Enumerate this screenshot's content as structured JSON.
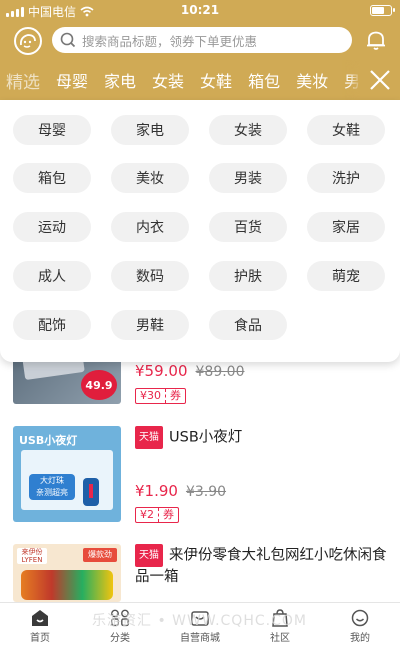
{
  "status": {
    "carrier": "中国电信",
    "time": "10:21"
  },
  "header": {
    "search_placeholder": "搜索商品标题，领券下单更优惠"
  },
  "category_tabs": [
    "精选",
    "母婴",
    "家电",
    "女装",
    "女鞋",
    "箱包",
    "美妆",
    "男"
  ],
  "category_panel": [
    "母婴",
    "家电",
    "女装",
    "女鞋",
    "箱包",
    "美妆",
    "男装",
    "洗护",
    "运动",
    "内衣",
    "百货",
    "家居",
    "成人",
    "数码",
    "护肤",
    "萌宠",
    "配饰",
    "男鞋",
    "食品"
  ],
  "products": [
    {
      "thumb_label": "49.9",
      "price": "¥59.00",
      "old_price": "¥89.00",
      "coupon_amount": "¥30",
      "coupon_label": "券"
    },
    {
      "shop_badge": "天猫",
      "title": "USB小夜灯",
      "thumb_label": "USB小夜灯",
      "thumb_sub": "大灯珠",
      "thumb_sub2": "亲测超亮",
      "price": "¥1.90",
      "old_price": "¥3.90",
      "coupon_amount": "¥2",
      "coupon_label": "券"
    },
    {
      "shop_badge": "天猫",
      "title": "来伊份零食大礼包网红小吃休闲食品一箱",
      "thumb_label": "来伊份",
      "thumb_sub": "LYFEN",
      "thumb_sub2": "爆款劲"
    }
  ],
  "tabbar": [
    "首页",
    "分类",
    "自营商城",
    "社区",
    "我的"
  ],
  "watermark": "乐游资汇 • WWW.CQHC.COM",
  "colors": {
    "brand": "#d0aa55",
    "price": "#e8264b"
  }
}
